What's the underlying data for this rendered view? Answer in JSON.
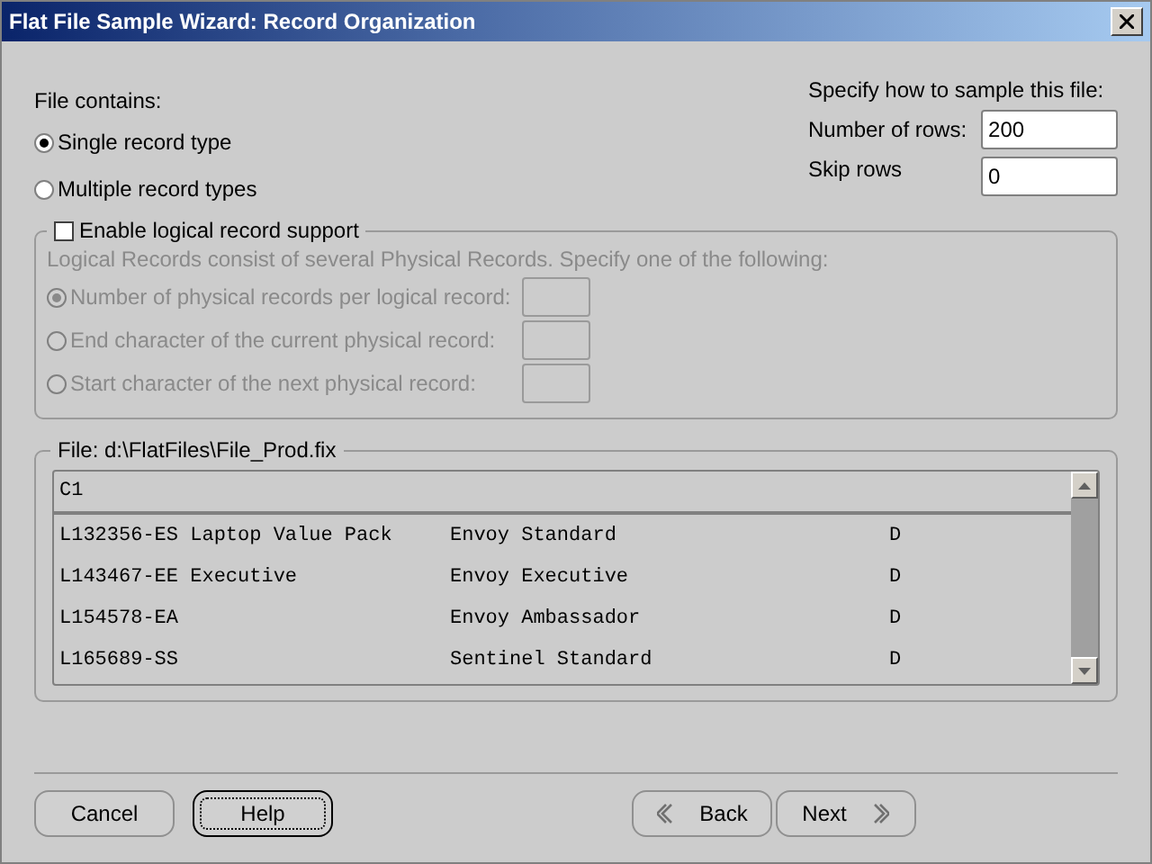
{
  "window": {
    "title": "Flat File Sample Wizard: Record Organization"
  },
  "file_contains": {
    "label": "File contains:",
    "options": [
      {
        "label": "Single record type",
        "selected": true
      },
      {
        "label": "Multiple record types",
        "selected": false
      }
    ]
  },
  "sampling": {
    "label": "Specify how to sample this file:",
    "fields": [
      {
        "label": "Number of rows:",
        "value": "200"
      },
      {
        "label": "Skip rows",
        "value": "0"
      }
    ]
  },
  "logical_records": {
    "label": "Enable logical record support",
    "checked": false,
    "description": "Logical Records consist of several Physical Records. Specify one of the following:",
    "options": [
      {
        "label": "Number of physical records per logical record:",
        "selected": true
      },
      {
        "label": "End character of the current physical record:",
        "selected": false
      },
      {
        "label": "Start character of the next physical record:",
        "selected": false
      }
    ]
  },
  "file_preview": {
    "label": "File: d:\\FlatFiles\\File_Prod.fix",
    "header": "C1",
    "rows": [
      [
        "L132356-ES Laptop Value Pack",
        "Envoy Standard",
        "D"
      ],
      [
        "L143467-EE Executive",
        "Envoy Executive",
        "D"
      ],
      [
        "L154578-EA",
        "Envoy Ambassador",
        "D"
      ],
      [
        "L165689-SS",
        "Sentinel Standard",
        "D"
      ]
    ]
  },
  "buttons": [
    {
      "label": "Cancel",
      "kind": "plain",
      "focused": false
    },
    {
      "label": "Help",
      "kind": "plain",
      "focused": true
    },
    {
      "label": "Back",
      "kind": "back",
      "focused": false
    },
    {
      "label": "Next",
      "kind": "next",
      "focused": false
    }
  ]
}
